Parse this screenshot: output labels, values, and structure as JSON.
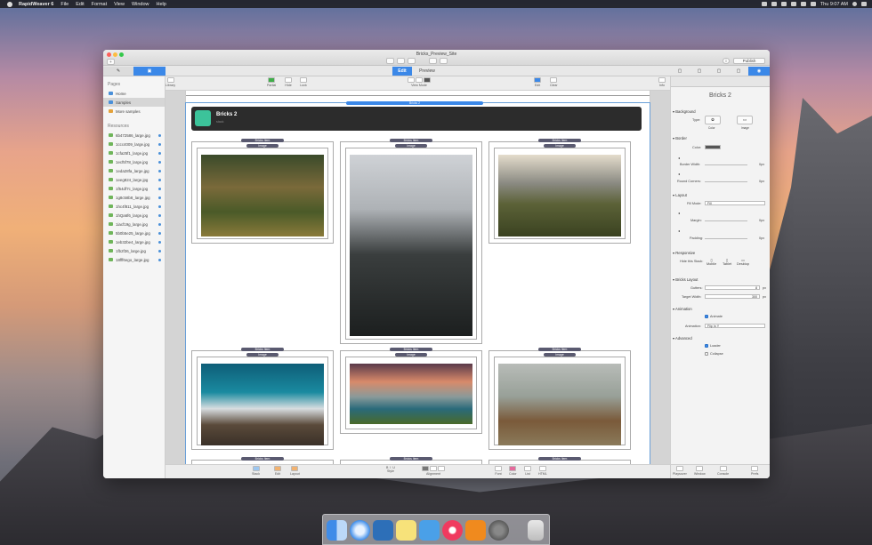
{
  "menubar": {
    "app": "RapidWeaver 6",
    "items": [
      "File",
      "Edit",
      "Format",
      "View",
      "Window",
      "Help"
    ],
    "clock": "Thu 9:07 AM"
  },
  "window": {
    "title": "Bricks_Preview_Site",
    "publish": "Publish"
  },
  "toolbar": {
    "edit": "Edit",
    "preview": "Preview"
  },
  "subbar": {
    "library": "Library",
    "partial": "Partial",
    "hide": "Hide",
    "lock": "Lock",
    "view_mode": "View Mode",
    "edit": "Edit",
    "clear": "Clear",
    "info": "Info"
  },
  "sidebar": {
    "pages_header": "Pages",
    "pages": [
      "Home",
      "Samples",
      "More samples"
    ],
    "resources_header": "Resources",
    "resources": [
      "6b472586_large.jpg",
      "1ccc4009_large.jpg",
      "1cfa25f1_large.jpg",
      "1ecf5f78_large.jpg",
      "1eda28fa_large.jpg",
      "1eeg824_large.jpg",
      "1f54df7c_large.jpg",
      "1g8c58b8_large.jpg",
      "1hc4f811_large.jpg",
      "1hQa6f6_large.jpg",
      "1iacf19g_large.jpg",
      "5b0b5e25_large.jpg",
      "1eb32be4_large.jpg",
      "1fb2f36_large.jpg",
      "18fff6ego_large.jpg"
    ]
  },
  "canvas": {
    "brick_label": "Bricks 2",
    "header_title": "Bricks 2",
    "header_sub": "stack",
    "item_label": "Bricks Item",
    "image_label": "Image"
  },
  "footbar": {
    "stack": "Stack",
    "edit": "Edit",
    "layout": "Layout",
    "style": "Style",
    "alignment": "Alignment",
    "font": "Font",
    "color": "Color",
    "list": "List",
    "html": "HTML"
  },
  "inspector": {
    "title": "Bricks 2",
    "background": {
      "header": "Background",
      "type_label": "Type:",
      "color": "Color",
      "image": "Image"
    },
    "border": {
      "header": "Border",
      "color_label": "Color:",
      "width_label": "Border Width:",
      "width_val": "0px",
      "corners_label": "Round Corners:",
      "corners_val": "0px"
    },
    "layout": {
      "header": "Layout",
      "fill_label": "Fill Mode:",
      "fill_val": "Fill",
      "margin_label": "Margin:",
      "margin_val": "0px",
      "padding_label": "Padding:",
      "padding_val": "0px"
    },
    "responsive": {
      "header": "Responsive",
      "hide_label": "Hide this Stack:",
      "mobile": "Mobile",
      "tablet": "Tablet",
      "desktop": "Desktop"
    },
    "bricks_layout": {
      "header": "Bricks Layout",
      "gutters_label": "Gutters:",
      "gutters_val": "8",
      "gutters_unit": "px",
      "target_label": "Target Width:",
      "target_val": "300",
      "target_unit": "px"
    },
    "animation": {
      "header": "Animation",
      "animate_label": "Animate",
      "anim_label": "Animation:",
      "anim_val": "Flip In Y"
    },
    "advanced": {
      "header": "Advanced",
      "loader": "Loader",
      "collapse": "Collapse"
    },
    "bottom": {
      "playsover": "Playsover",
      "window": "Window",
      "console": "Console",
      "prefs": "Prefs"
    }
  }
}
